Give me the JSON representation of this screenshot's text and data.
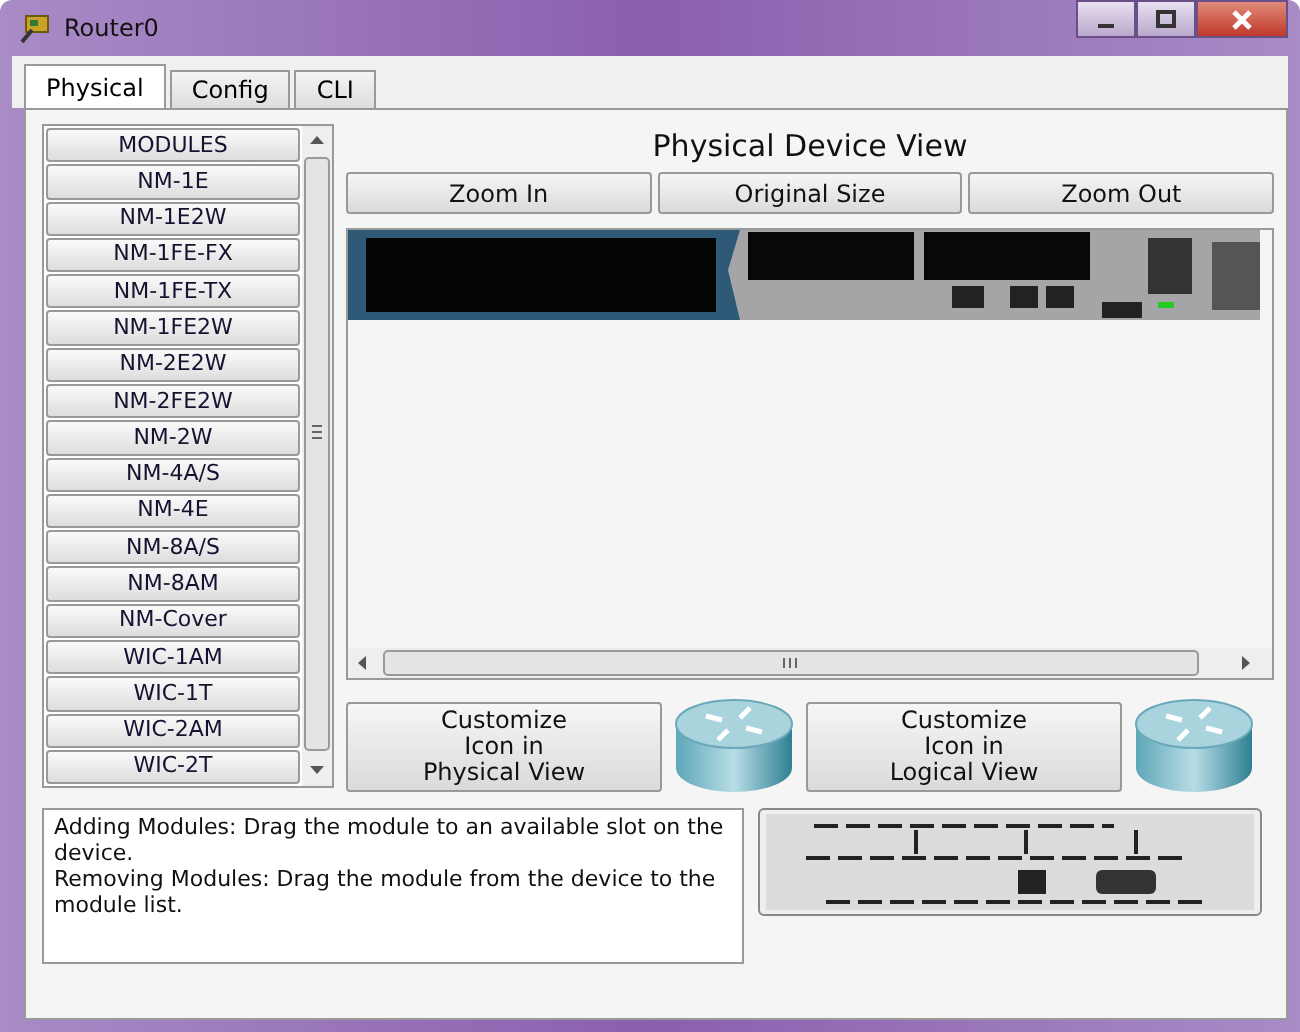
{
  "window": {
    "title": "Router0"
  },
  "tabs": [
    {
      "label": "Physical",
      "selected": true
    },
    {
      "label": "Config",
      "selected": false
    },
    {
      "label": "CLI",
      "selected": false
    }
  ],
  "modules": {
    "header": "MODULES",
    "items": [
      "NM-1E",
      "NM-1E2W",
      "NM-1FE-FX",
      "NM-1FE-TX",
      "NM-1FE2W",
      "NM-2E2W",
      "NM-2FE2W",
      "NM-2W",
      "NM-4A/S",
      "NM-4E",
      "NM-8A/S",
      "NM-8AM",
      "NM-Cover",
      "WIC-1AM",
      "WIC-1T",
      "WIC-2AM",
      "WIC-2T"
    ]
  },
  "view": {
    "title": "Physical Device View",
    "buttons": [
      "Zoom In",
      "Original Size",
      "Zoom Out"
    ]
  },
  "customize": [
    {
      "label": "Customize\nIcon in\nPhysical View"
    },
    {
      "label": "Customize\nIcon in\nLogical View"
    }
  ],
  "help": [
    "Adding Modules: Drag the module to an available slot on the device.",
    "Removing Modules: Drag the module from the device to the module list."
  ]
}
